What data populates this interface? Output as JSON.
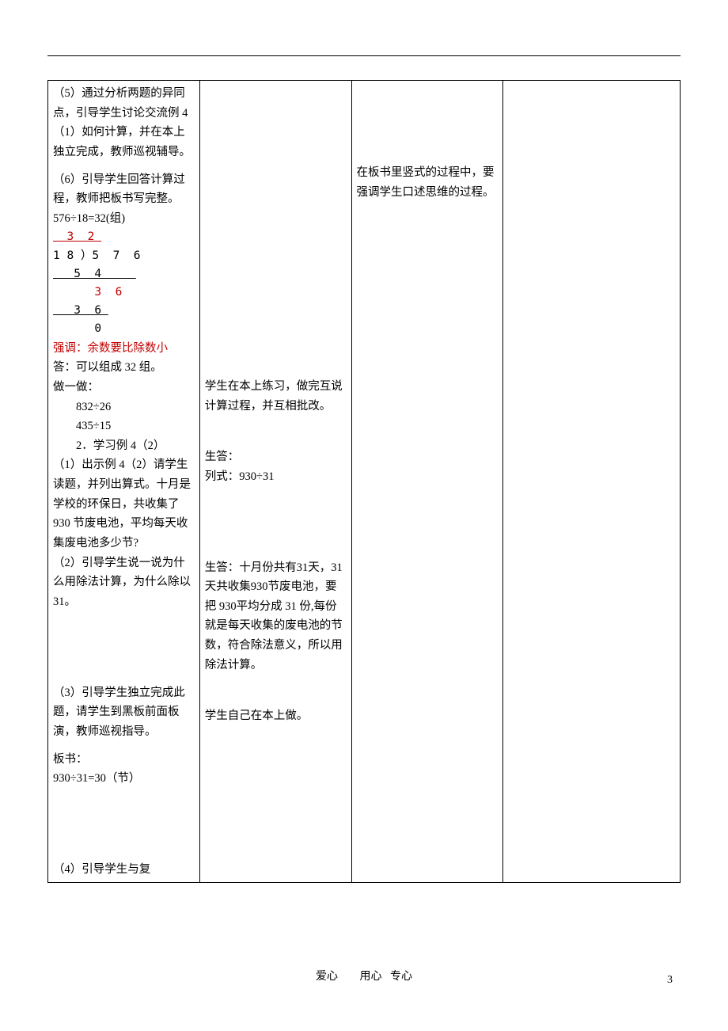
{
  "col1": {
    "p5": "（5）通过分析两题的异同点，引导学生讨论交流例 4（1）如何计算，并在本上独立完成，教师巡视辅导。",
    "p6": "（6）引导学生回答计算过程，教师把板书写完整。",
    "eq1": "576÷18=32(组)",
    "div_quotient": "  3  2 ",
    "div_line2": "1 8 ）5  7  6",
    "div_line3": "   5  4     ",
    "div_line4": "      3  6",
    "div_line5": "   3  6 ",
    "div_line6": "      0",
    "emph": "强调：余数要比除数小",
    "ans": "答：可以组成 32 组。",
    "doit": "做一做：",
    "doit1": "832÷26",
    "doit2": "435÷15",
    "ex4_2": "2．学习例 4（2）",
    "p4_2_1": "（1）出示例 4（2）请学生读题，并列出算式。十月是学校的环保日，共收集了930 节废电池，平均每天收集废电池多少节?",
    "p4_2_2": "（2）引导学生说一说为什么用除法计算，为什么除以 31。",
    "p4_2_3": "（3）引导学生独立完成此题，请学生到黑板前面板演，教师巡视指导。",
    "board": "板书：",
    "eq2": "930÷31=30（节）",
    "p4_2_4": "（4）引导学生与复"
  },
  "col2": {
    "s1": "学生在本上练习，做完互说计算过程，并互相批改。",
    "s2a": "生答：",
    "s2b": "列式：930÷31",
    "s3": "生答：十月份共有31天，31 天共收集930节废电池，要把 930平均分成 31 份,每份就是每天收集的废电池的节数，符合除法意义，所以用除法计算。",
    "s4": "学生自己在本上做。"
  },
  "col3": {
    "note": "在板书里竖式的过程中，要强调学生口述思维的过程。"
  },
  "footer": {
    "love": "爱心",
    "heart": "用心",
    "ded": "专心",
    "page": "3"
  }
}
